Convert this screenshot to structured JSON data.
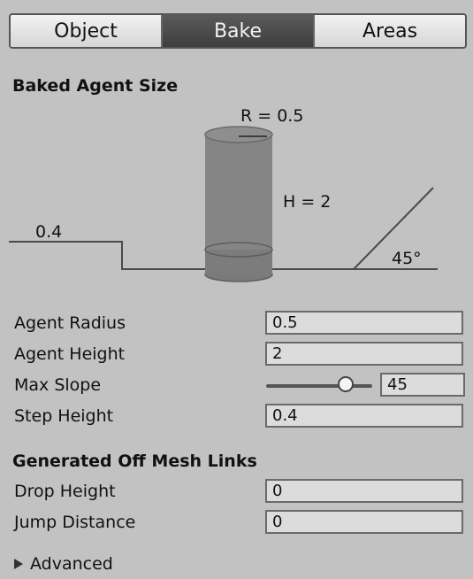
{
  "tabs": [
    {
      "label": "Object",
      "active": false
    },
    {
      "label": "Bake",
      "active": true
    },
    {
      "label": "Areas",
      "active": false
    }
  ],
  "baked_agent_size": {
    "title": "Baked Agent Size",
    "radius_label": "R = 0.5",
    "height_label": "H = 2",
    "step_label": "0.4",
    "slope_label": "45°"
  },
  "fields": {
    "agent_radius": {
      "label": "Agent Radius",
      "value": "0.5"
    },
    "agent_height": {
      "label": "Agent Height",
      "value": "2"
    },
    "max_slope": {
      "label": "Max Slope",
      "value": "45",
      "slider_fraction": 0.75
    },
    "step_height": {
      "label": "Step Height",
      "value": "0.4"
    }
  },
  "off_mesh_links": {
    "title": "Generated Off Mesh Links",
    "drop_height": {
      "label": "Drop Height",
      "value": "0"
    },
    "jump_distance": {
      "label": "Jump Distance",
      "value": "0"
    }
  },
  "advanced": {
    "label": "Advanced",
    "expanded": false
  }
}
